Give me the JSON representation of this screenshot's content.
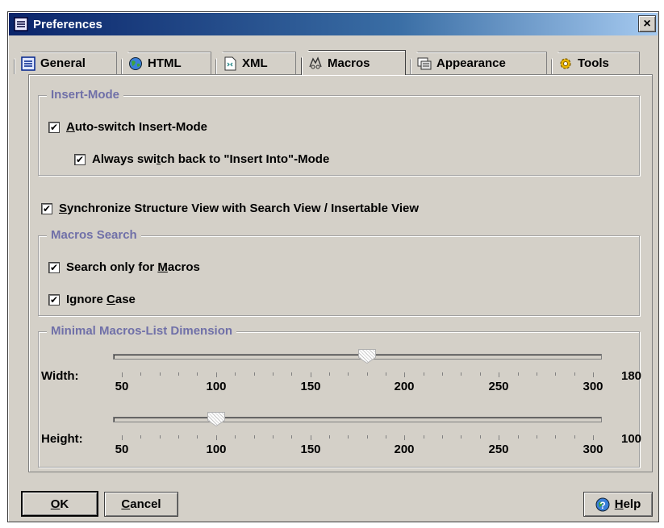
{
  "window": {
    "title": "Preferences",
    "close_label": "×"
  },
  "tabs": [
    {
      "label": "General",
      "icon": "list-icon",
      "active": false
    },
    {
      "label": "HTML",
      "icon": "globe-icon",
      "active": false
    },
    {
      "label": "XML",
      "icon": "xml-doc-icon",
      "active": false
    },
    {
      "label": "Macros",
      "icon": "macros-icon",
      "active": true
    },
    {
      "label": "Appearance",
      "icon": "appearance-icon",
      "active": false
    },
    {
      "label": "Tools",
      "icon": "gear-icon",
      "active": false
    }
  ],
  "insert_mode": {
    "title": "Insert-Mode",
    "auto_switch": {
      "pre": "",
      "mn": "A",
      "post": "uto-switch Insert-Mode",
      "checked": true
    },
    "always_switch": {
      "pre": "Always swi",
      "mn": "t",
      "post": "ch back to \"Insert Into\"-Mode",
      "checked": true
    }
  },
  "synchronize": {
    "pre": "",
    "mn": "S",
    "post": "ynchronize Structure View with Search View / Insertable View",
    "checked": true
  },
  "macros_search": {
    "title": "Macros Search",
    "search_only": {
      "pre": "Search only for ",
      "mn": "M",
      "post": "acros",
      "checked": true
    },
    "ignore_case": {
      "pre": "Ignore ",
      "mn": "C",
      "post": "ase",
      "checked": true
    }
  },
  "dimension": {
    "title": "Minimal Macros-List Dimension",
    "width": {
      "label": "Width:",
      "value": 180,
      "value_text": "180"
    },
    "height": {
      "label": "Height:",
      "value": 100,
      "value_text": "100"
    },
    "min": 50,
    "max": 300,
    "scale_labels": [
      "50",
      "100",
      "150",
      "200",
      "250",
      "300"
    ]
  },
  "buttons": {
    "ok": {
      "mn": "O",
      "post": "K"
    },
    "cancel": {
      "mn": "C",
      "post": "ancel"
    },
    "help": {
      "mn": "H",
      "post": "elp"
    }
  },
  "colors": {
    "title_bar": "#0a246a",
    "group_title": "#7070a8",
    "face": "#d4d0c8"
  }
}
